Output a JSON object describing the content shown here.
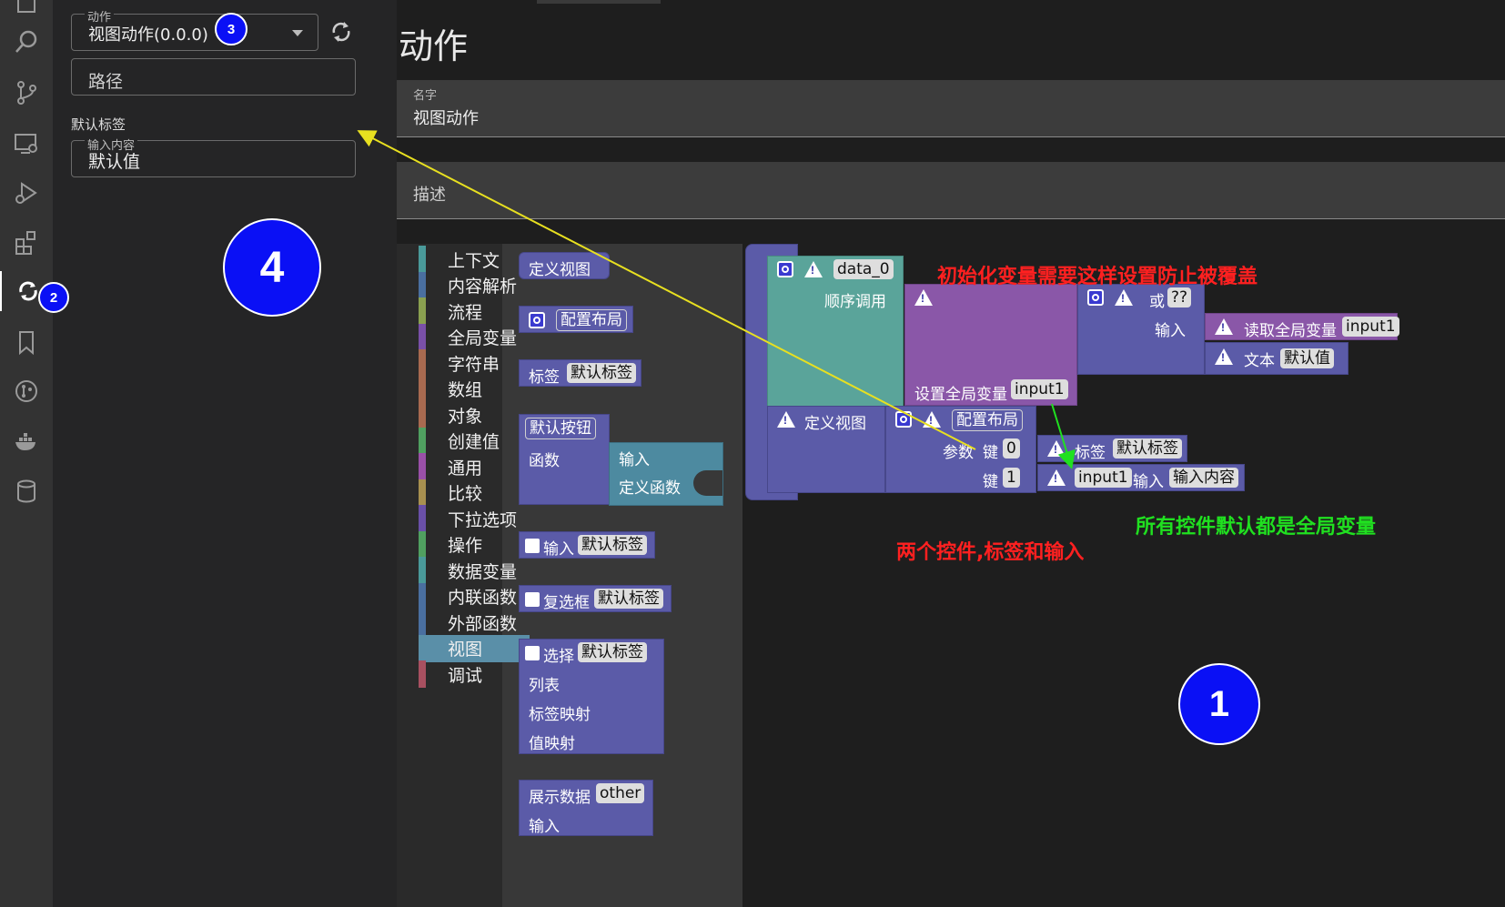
{
  "activity_bar": {
    "icons": [
      "explorer-icon",
      "search-icon",
      "source-control-icon",
      "remote-explorer-icon",
      "run-debug-icon",
      "extensions-icon",
      "sync-icon",
      "bookmark-icon",
      "git-graph-icon",
      "docker-icon",
      "database-icon"
    ],
    "active": "sync-icon",
    "badge_2": "2"
  },
  "side_panel": {
    "action_select": {
      "label": "动作",
      "value": "视图动作(0.0.0)"
    },
    "badge_3": "3",
    "path_input": {
      "placeholder": "路径"
    },
    "default_label_title": "默认标签",
    "input_field": {
      "label": "输入内容",
      "value": "默认值"
    },
    "badge_4": "4"
  },
  "main": {
    "title": "动作",
    "name_field": {
      "label": "名字",
      "value": "视图动作"
    },
    "desc_field": {
      "placeholder": "描述"
    },
    "categories": [
      {
        "label": "上下文",
        "color": "#4a9a9a"
      },
      {
        "label": "内容解析",
        "color": "#4a6fa0"
      },
      {
        "label": "流程",
        "color": "#8aa050"
      },
      {
        "label": "全局变量",
        "color": "#7a50a8"
      },
      {
        "label": "字符串",
        "color": "#a86a50"
      },
      {
        "label": "数组",
        "color": "#a86a50"
      },
      {
        "label": "对象",
        "color": "#a86a50"
      },
      {
        "label": "创建值",
        "color": "#50a060"
      },
      {
        "label": "通用",
        "color": "#9a50a8"
      },
      {
        "label": "比较",
        "color": "#a89050"
      },
      {
        "label": "下拉选项",
        "color": "#6a50a8"
      },
      {
        "label": "操作",
        "color": "#50a060"
      },
      {
        "label": "数据变量",
        "color": "#4a9a9a"
      },
      {
        "label": "内联函数",
        "color": "#4a6fa0"
      },
      {
        "label": "外部函数",
        "color": "#4a6fa0"
      },
      {
        "label": "视图",
        "color": "#5a8fa8"
      },
      {
        "label": "调试",
        "color": "#a85060"
      }
    ],
    "selected_category": "视图",
    "flyout": {
      "define_view": "定义视图",
      "config_layout": "配置布局",
      "label_block": {
        "label": "标签",
        "value": "默认标签"
      },
      "default_button": {
        "label": "默认按钮",
        "func": "函数",
        "input": "输入",
        "define_func": "定义函数"
      },
      "input_block": {
        "label": "输入",
        "value": "默认标签"
      },
      "checkbox_block": {
        "label": "复选框",
        "value": "默认标签"
      },
      "select_block": {
        "label": "选择",
        "value": "默认标签",
        "list": "列表",
        "label_map": "标签映射",
        "value_map": "值映射"
      },
      "display_block": {
        "label": "展示数据",
        "value": "other",
        "input": "输入"
      }
    },
    "workspace": {
      "data_var": "data_0",
      "seq_call": "顺序调用",
      "set_global": "设置全局变量",
      "set_global_var": "input1",
      "or": "或",
      "or_value": "??",
      "input": "输入",
      "read_global": "读取全局变量",
      "read_global_var": "input1",
      "text": "文本",
      "text_value": "默认值",
      "define_view": "定义视图",
      "config_layout": "配置布局",
      "params": "参数",
      "key": "键",
      "key0": "0",
      "key1": "1",
      "label": "标签",
      "label_value": "默认标签",
      "input_var": "input1",
      "input_label": "输入",
      "input_value": "输入内容"
    },
    "annotations": {
      "red_top": "初始化变量需要这样设置防止被覆盖",
      "red_bottom": "两个控件,标签和输入",
      "green": "所有控件默认都是全局变量",
      "badge_1": "1"
    }
  }
}
